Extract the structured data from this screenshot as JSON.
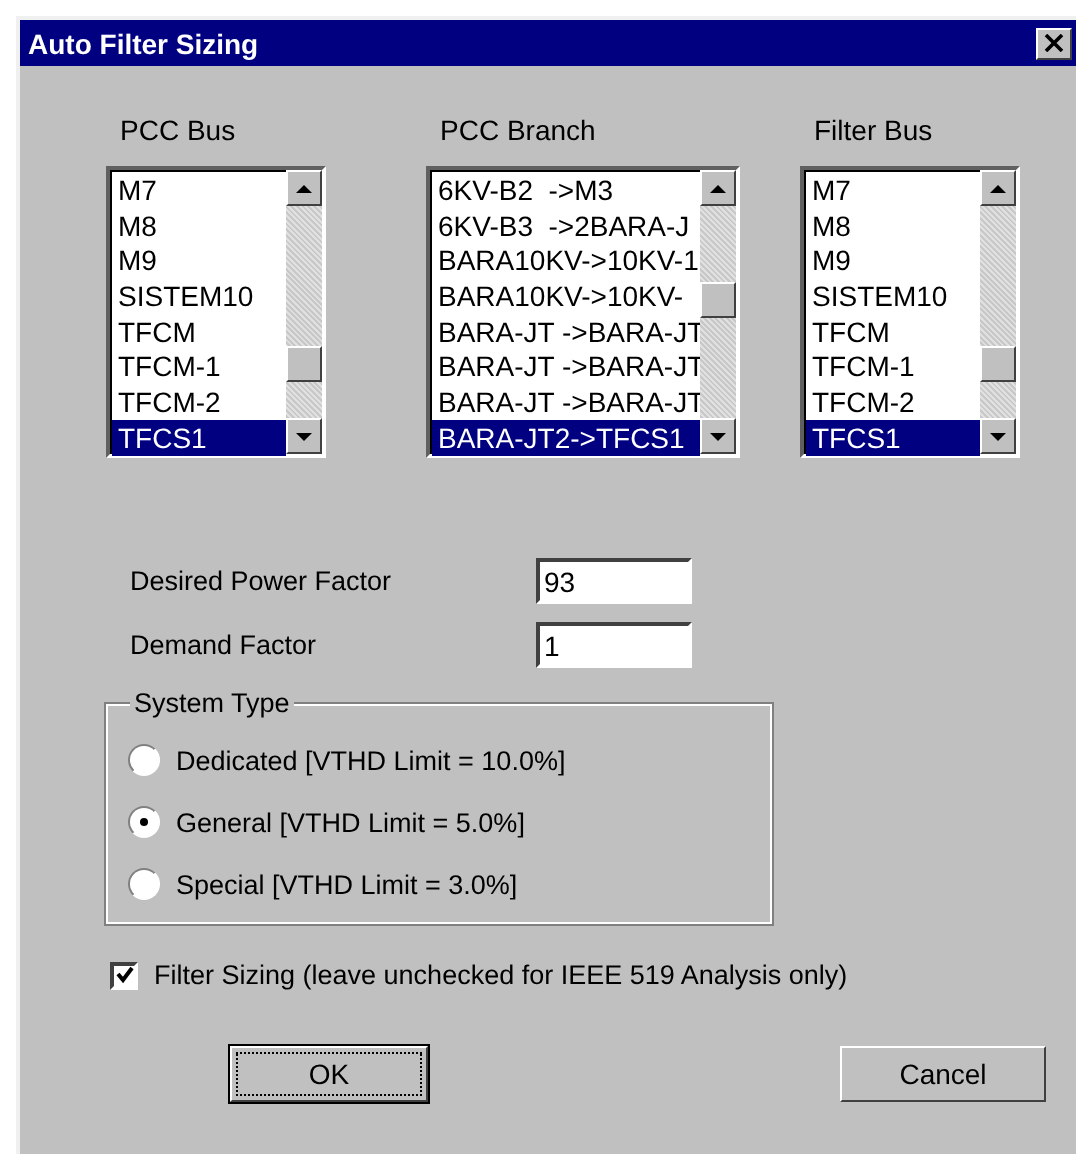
{
  "window": {
    "title": "Auto Filter Sizing"
  },
  "lists": [
    {
      "label": "PCC Bus",
      "items": [
        {
          "text": "M7",
          "selected": false
        },
        {
          "text": "M8",
          "selected": false
        },
        {
          "text": "M9",
          "selected": false
        },
        {
          "text": "SISTEM10",
          "selected": false
        },
        {
          "text": "TFCM",
          "selected": false
        },
        {
          "text": "TFCM-1",
          "selected": false
        },
        {
          "text": "TFCM-2",
          "selected": false
        },
        {
          "text": "TFCS1",
          "selected": true
        }
      ]
    },
    {
      "label": "PCC Branch",
      "items": [
        {
          "text": "6KV-B2  ->M3",
          "selected": false
        },
        {
          "text": "6KV-B3  ->2BARA-J",
          "selected": false
        },
        {
          "text": "BARA10KV->10KV-1",
          "selected": false
        },
        {
          "text": "BARA10KV->10KV-",
          "selected": false
        },
        {
          "text": "BARA-JT ->BARA-JT",
          "selected": false
        },
        {
          "text": "BARA-JT ->BARA-JT",
          "selected": false
        },
        {
          "text": "BARA-JT ->BARA-JT",
          "selected": false
        },
        {
          "text": "BARA-JT2->TFCS1",
          "selected": true
        }
      ]
    },
    {
      "label": "Filter Bus",
      "items": [
        {
          "text": "M7",
          "selected": false
        },
        {
          "text": "M8",
          "selected": false
        },
        {
          "text": "M9",
          "selected": false
        },
        {
          "text": "SISTEM10",
          "selected": false
        },
        {
          "text": "TFCM",
          "selected": false
        },
        {
          "text": "TFCM-1",
          "selected": false
        },
        {
          "text": "TFCM-2",
          "selected": false
        },
        {
          "text": "TFCS1",
          "selected": true
        }
      ]
    }
  ],
  "fields": [
    {
      "label": "Desired Power Factor",
      "value": "93"
    },
    {
      "label": "Demand Factor",
      "value": "1"
    }
  ],
  "system_type": {
    "title": "System Type",
    "options": [
      {
        "label": "Dedicated [VTHD Limit = 10.0%]",
        "selected": false
      },
      {
        "label": "General [VTHD Limit = 5.0%]",
        "selected": true
      },
      {
        "label": "Special [VTHD Limit = 3.0%]",
        "selected": false
      }
    ]
  },
  "filter_sizing": {
    "label": "Filter Sizing (leave unchecked for IEEE 519 Analysis only)",
    "checked": true
  },
  "buttons": [
    {
      "label": "OK",
      "focused": true
    },
    {
      "label": "Cancel",
      "focused": false
    }
  ]
}
